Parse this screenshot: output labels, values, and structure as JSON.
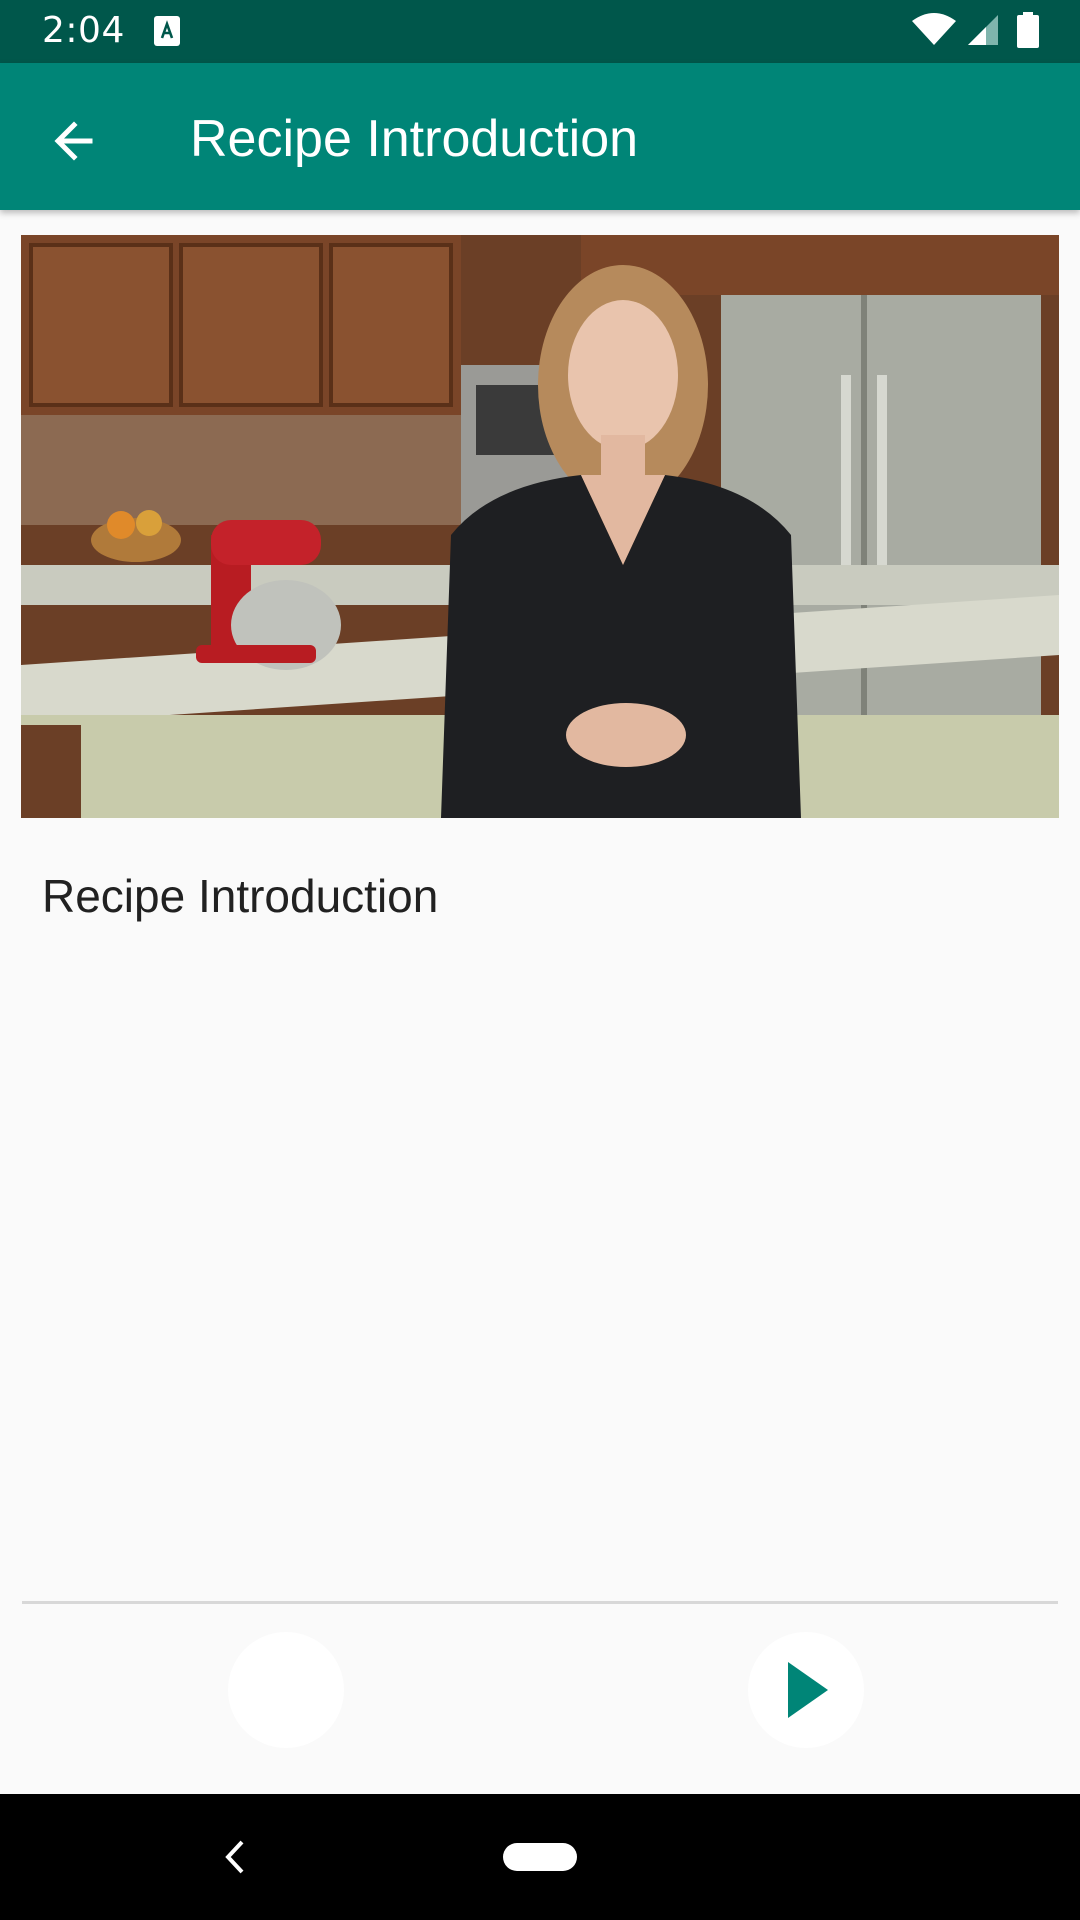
{
  "status_bar": {
    "time": "2:04"
  },
  "app_bar": {
    "title": "Recipe Introduction"
  },
  "step": {
    "title": "Recipe Introduction"
  },
  "colors": {
    "status_bar": "#00574b",
    "app_bar": "#008577",
    "accent": "#008577",
    "background": "#fafafa"
  },
  "icons": {
    "back": "arrow-left-icon",
    "next": "play-arrow-icon",
    "nav_back": "chevron-left-icon"
  }
}
